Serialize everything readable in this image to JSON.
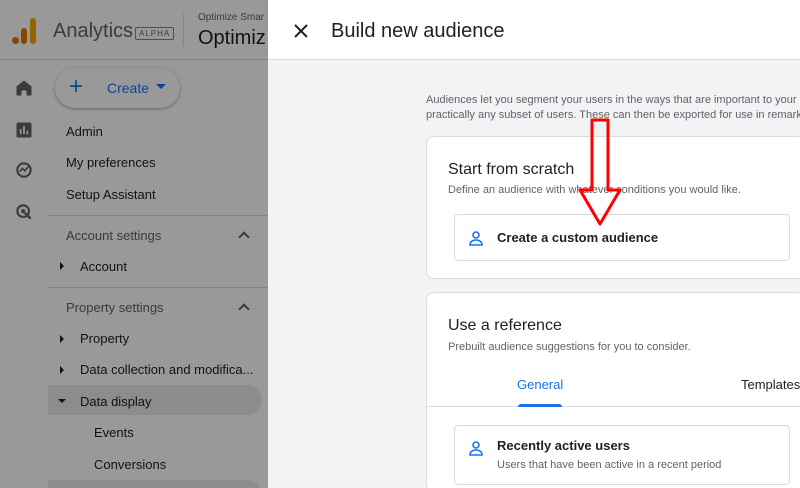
{
  "app": {
    "name": "Analytics",
    "badge": "ALPHA",
    "account_small": "Optimize Smar",
    "account_big": "Optimiz"
  },
  "nav": {
    "create_label": "Create",
    "items": [
      "Admin",
      "My preferences",
      "Setup Assistant"
    ],
    "account_section": "Account settings",
    "account_item": "Account",
    "property_section": "Property settings",
    "property_items": [
      "Property",
      "Data collection and modifica...",
      "Data display"
    ],
    "data_display_sub": [
      "Events",
      "Conversions"
    ]
  },
  "panel": {
    "title": "Build new audience",
    "intro_line1": "Audiences let you segment your users in the ways that are important to your",
    "intro_line2": "practically any subset of users. These can then be exported for use in remark",
    "scratch": {
      "title": "Start from scratch",
      "subtitle": "Define an audience with whatever conditions you would like.",
      "option": "Create a custom audience"
    },
    "reference": {
      "title": "Use a reference",
      "subtitle": "Prebuilt audience suggestions for you to consider.",
      "tabs": [
        "General",
        "Templates"
      ],
      "option_title": "Recently active users",
      "option_sub": "Users that have been active in a recent period"
    }
  },
  "colors": {
    "accent": "#1a73e8",
    "annotation": "#ff0000"
  }
}
